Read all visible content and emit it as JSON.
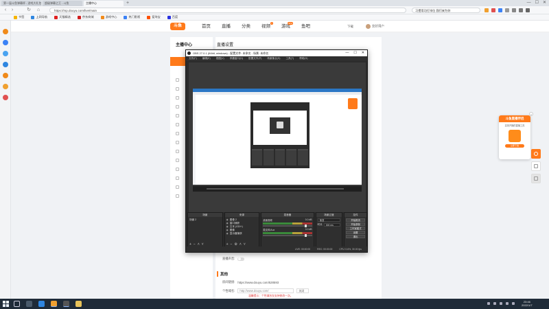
{
  "browser": {
    "tabs": [
      {
        "label": "第一届斗鱼弹幕杯 - 游戏大礼包"
      },
      {
        "label": "超级弹幕之王 - 斗鱼"
      },
      {
        "label": "主播中心",
        "active": true
      }
    ],
    "address": "https://mp.douyu.com/live/main",
    "search_box": "习惯用功打排位 我们来为你"
  },
  "bookmarks": [
    "书签",
    "上网导航",
    "天猫精选",
    "京东商城",
    "游戏中心",
    "热门影视",
    "爱淘宝",
    "百度"
  ],
  "site": {
    "logo": "斗鱼",
    "nav": [
      "首页",
      "直播",
      "分类",
      "视频",
      "游戏",
      "鱼吧"
    ],
    "nav_badges": {
      "视频": "1",
      "游戏": "new"
    },
    "user": {
      "upload": "下载",
      "name": "您好用户"
    }
  },
  "side_menu": {
    "title": "主播中心"
  },
  "content": {
    "title": "直播设置",
    "toggle_label": "直播声音:",
    "section_other": "其他",
    "room_link_label": "房间链接:",
    "room_link_value": "https://www.douyu.com/528593",
    "custom_domain_label": "个性域名:",
    "custom_domain_placeholder": "http://www.douyu.com/",
    "custom_domain_select": "关闭",
    "warning": "温馨提示：个性域名仅支持修改一次。"
  },
  "obs": {
    "title": "OBS 27.0.1 (64bit, windows) - 配置文件: 未命名 - 场景: 未命名",
    "menu": [
      "文件(F)",
      "编辑(E)",
      "视图(V)",
      "停靠窗口(D)",
      "配置文件(P)",
      "场景集合(S)",
      "工具(T)",
      "帮助(H)"
    ],
    "docks": {
      "scenes": {
        "header": "场景",
        "items": [
          "场景 2"
        ]
      },
      "sources": {
        "header": "来源",
        "items": [
          {
            "vis": "◉",
            "name": "图像 2"
          },
          {
            "vis": "◉",
            "name": "窗口捕获"
          },
          {
            "vis": "◉",
            "name": "文本 (GDI+)"
          },
          {
            "vis": "◉",
            "name": "图像"
          },
          {
            "vis": "◉",
            "name": "显示器捕获"
          }
        ]
      },
      "mixer": {
        "header": "混音器",
        "channels": [
          {
            "name": "桌面音频",
            "db": "0.0 dB"
          },
          {
            "name": "麦克风/Aux",
            "db": "0.0 dB"
          }
        ]
      },
      "transitions": {
        "header": "场景过渡",
        "type": "渐变",
        "duration_label": "时长",
        "duration": "300 ms"
      },
      "controls": {
        "header": "控件",
        "buttons": [
          "开始推流",
          "开始录制",
          "工作室模式",
          "设置",
          "退出"
        ]
      }
    },
    "status": [
      "LIVE: 00:00:00",
      "REC: 00:00:00",
      "CPU: 0.6%, 30.00 fps"
    ]
  },
  "promo": {
    "title": "斗鱼直播伴侣",
    "subtitle": "高效开播的直播工具",
    "button": "立即下载"
  },
  "taskbar": {
    "time": "23:46",
    "date": "2022/1/7"
  }
}
